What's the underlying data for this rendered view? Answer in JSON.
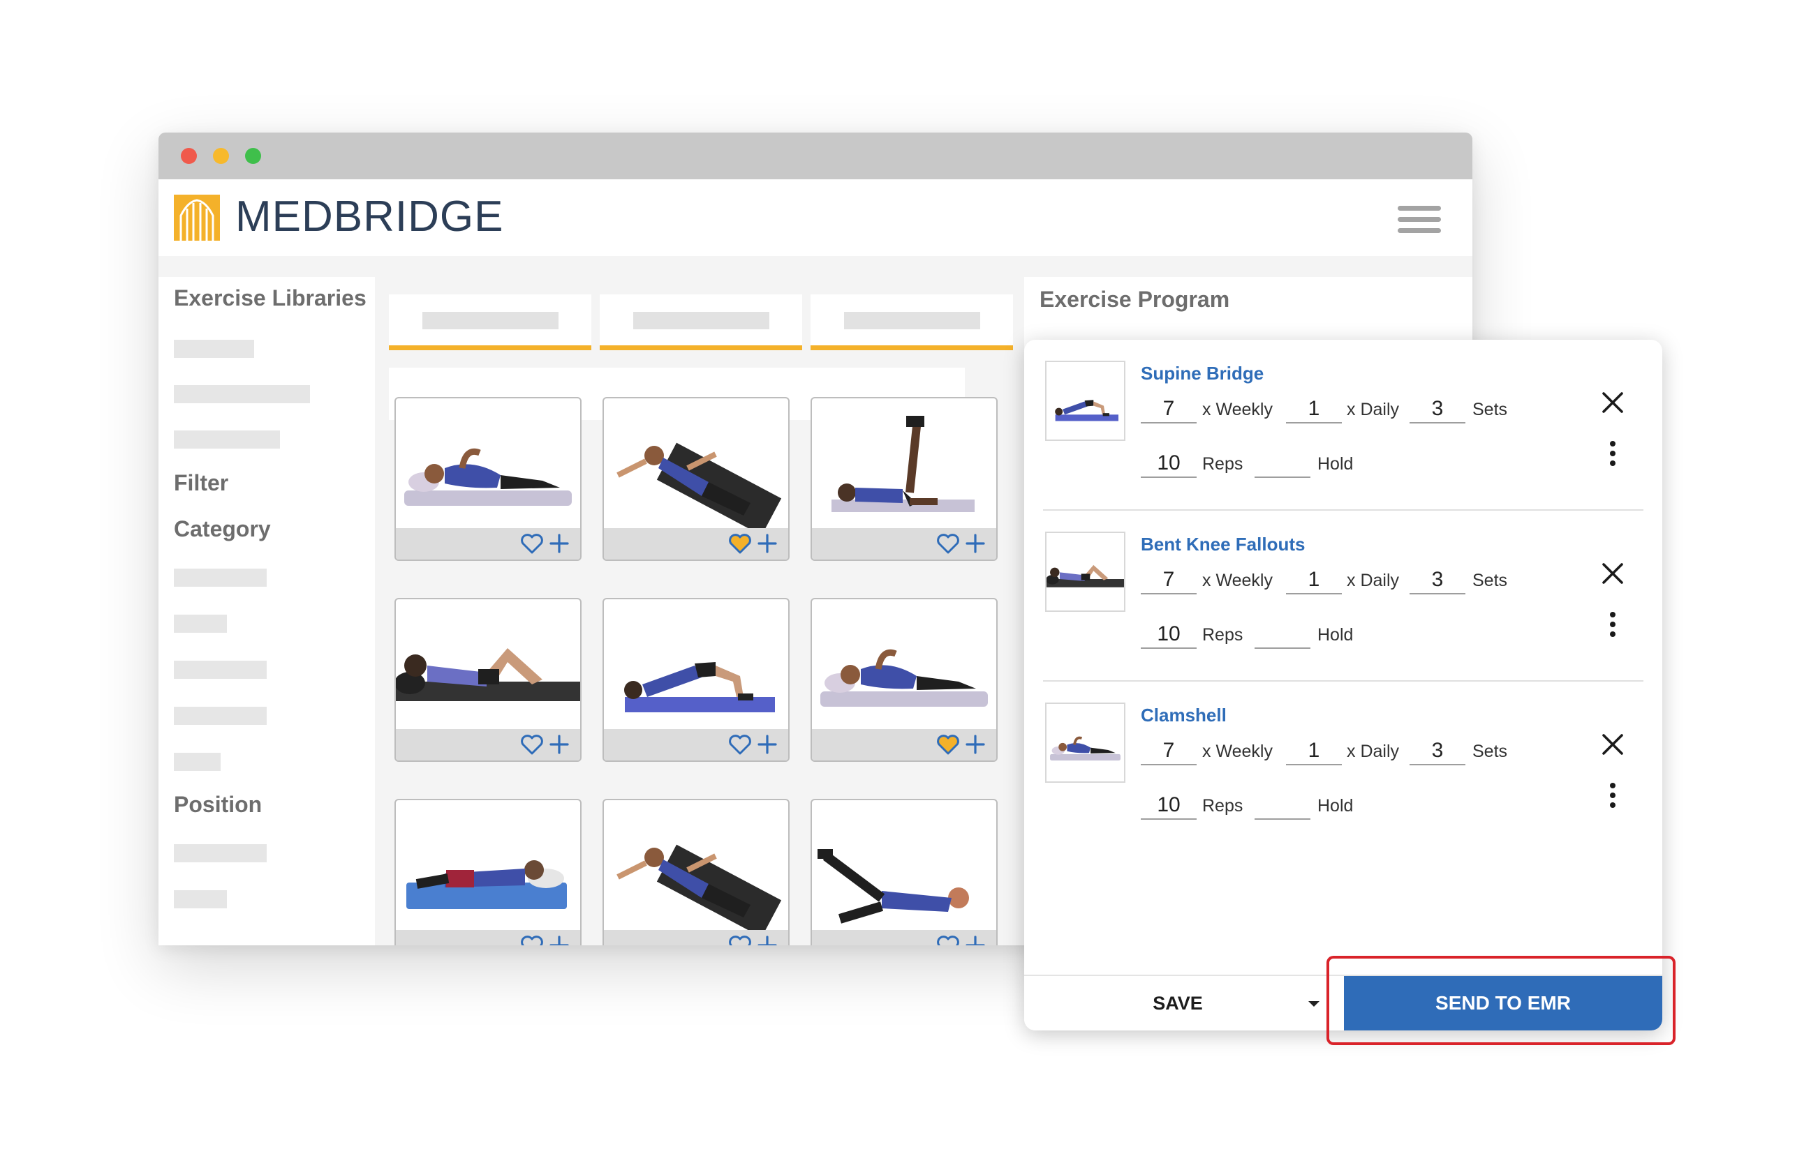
{
  "brand": {
    "name": "MEDBRIDGE",
    "accent_color": "#f4b12a",
    "primary_color": "#2f6cb8"
  },
  "window": {
    "controls": [
      "close",
      "minimize",
      "maximize"
    ]
  },
  "header": {
    "menu_icon": "hamburger-menu-icon"
  },
  "sidebar": {
    "libraries_heading": "Exercise Libraries",
    "filter_heading": "Filter",
    "category_heading": "Category",
    "position_heading": "Position"
  },
  "grid": {
    "cards": [
      {
        "pose": "side-lying",
        "favorited": false
      },
      {
        "pose": "supine-twist",
        "favorited": true
      },
      {
        "pose": "leg-raise",
        "favorited": false
      },
      {
        "pose": "supine-knees-bent",
        "favorited": false
      },
      {
        "pose": "bridge",
        "favorited": false
      },
      {
        "pose": "side-lying",
        "favorited": true
      },
      {
        "pose": "side-lying-band",
        "favorited": false
      },
      {
        "pose": "supine-twist",
        "favorited": false
      },
      {
        "pose": "side-leg-raise",
        "favorited": false
      }
    ],
    "favorite_color": "#f4b12a"
  },
  "program": {
    "title": "Exercise Program",
    "exercises": [
      {
        "name": "Supine Bridge",
        "weekly": "7",
        "weekly_label": "x Weekly",
        "daily": "1",
        "daily_label": "x Daily",
        "sets": "3",
        "sets_label": "Sets",
        "reps": "10",
        "reps_label": "Reps",
        "hold": "",
        "hold_label": "Hold"
      },
      {
        "name": "Bent Knee Fallouts",
        "weekly": "7",
        "weekly_label": "x Weekly",
        "daily": "1",
        "daily_label": "x Daily",
        "sets": "3",
        "sets_label": "Sets",
        "reps": "10",
        "reps_label": "Reps",
        "hold": "",
        "hold_label": "Hold"
      },
      {
        "name": "Clamshell",
        "weekly": "7",
        "weekly_label": "x Weekly",
        "daily": "1",
        "daily_label": "x Daily",
        "sets": "3",
        "sets_label": "Sets",
        "reps": "10",
        "reps_label": "Reps",
        "hold": "",
        "hold_label": "Hold"
      }
    ],
    "save_label": "SAVE",
    "send_label": "SEND TO EMR",
    "highlight_color": "#d9232a"
  }
}
